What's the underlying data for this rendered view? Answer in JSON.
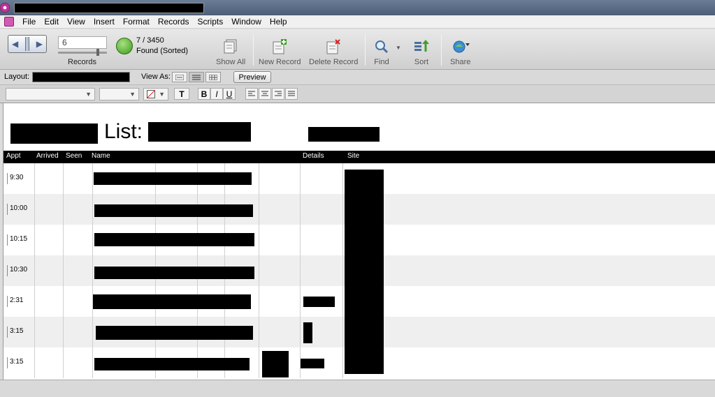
{
  "menu": [
    "File",
    "Edit",
    "View",
    "Insert",
    "Format",
    "Records",
    "Scripts",
    "Window",
    "Help"
  ],
  "toolbar": {
    "record_value": "6",
    "records_label": "Records",
    "found_count": "7 / 3450",
    "found_label": "Found (Sorted)",
    "found_fraction": 0.998,
    "show_all": "Show All",
    "new_record": "New Record",
    "delete_record": "Delete Record",
    "find": "Find",
    "sort": "Sort",
    "share": "Share"
  },
  "layoutbar": {
    "layout_label": "Layout:",
    "view_as_label": "View As:",
    "preview": "Preview"
  },
  "formatbar": {
    "bold": "B",
    "italic": "I",
    "underline": "U",
    "text_tool": "T"
  },
  "content": {
    "title": "List:"
  },
  "table": {
    "columns": [
      "Appt",
      "Arrived",
      "Seen",
      "Name",
      "Details",
      "Site"
    ],
    "rows": [
      {
        "appt": "9:30"
      },
      {
        "appt": "10:00"
      },
      {
        "appt": "10:15"
      },
      {
        "appt": "10:30"
      },
      {
        "appt": "2:31"
      },
      {
        "appt": "3:15"
      },
      {
        "appt": "3:15"
      }
    ]
  }
}
